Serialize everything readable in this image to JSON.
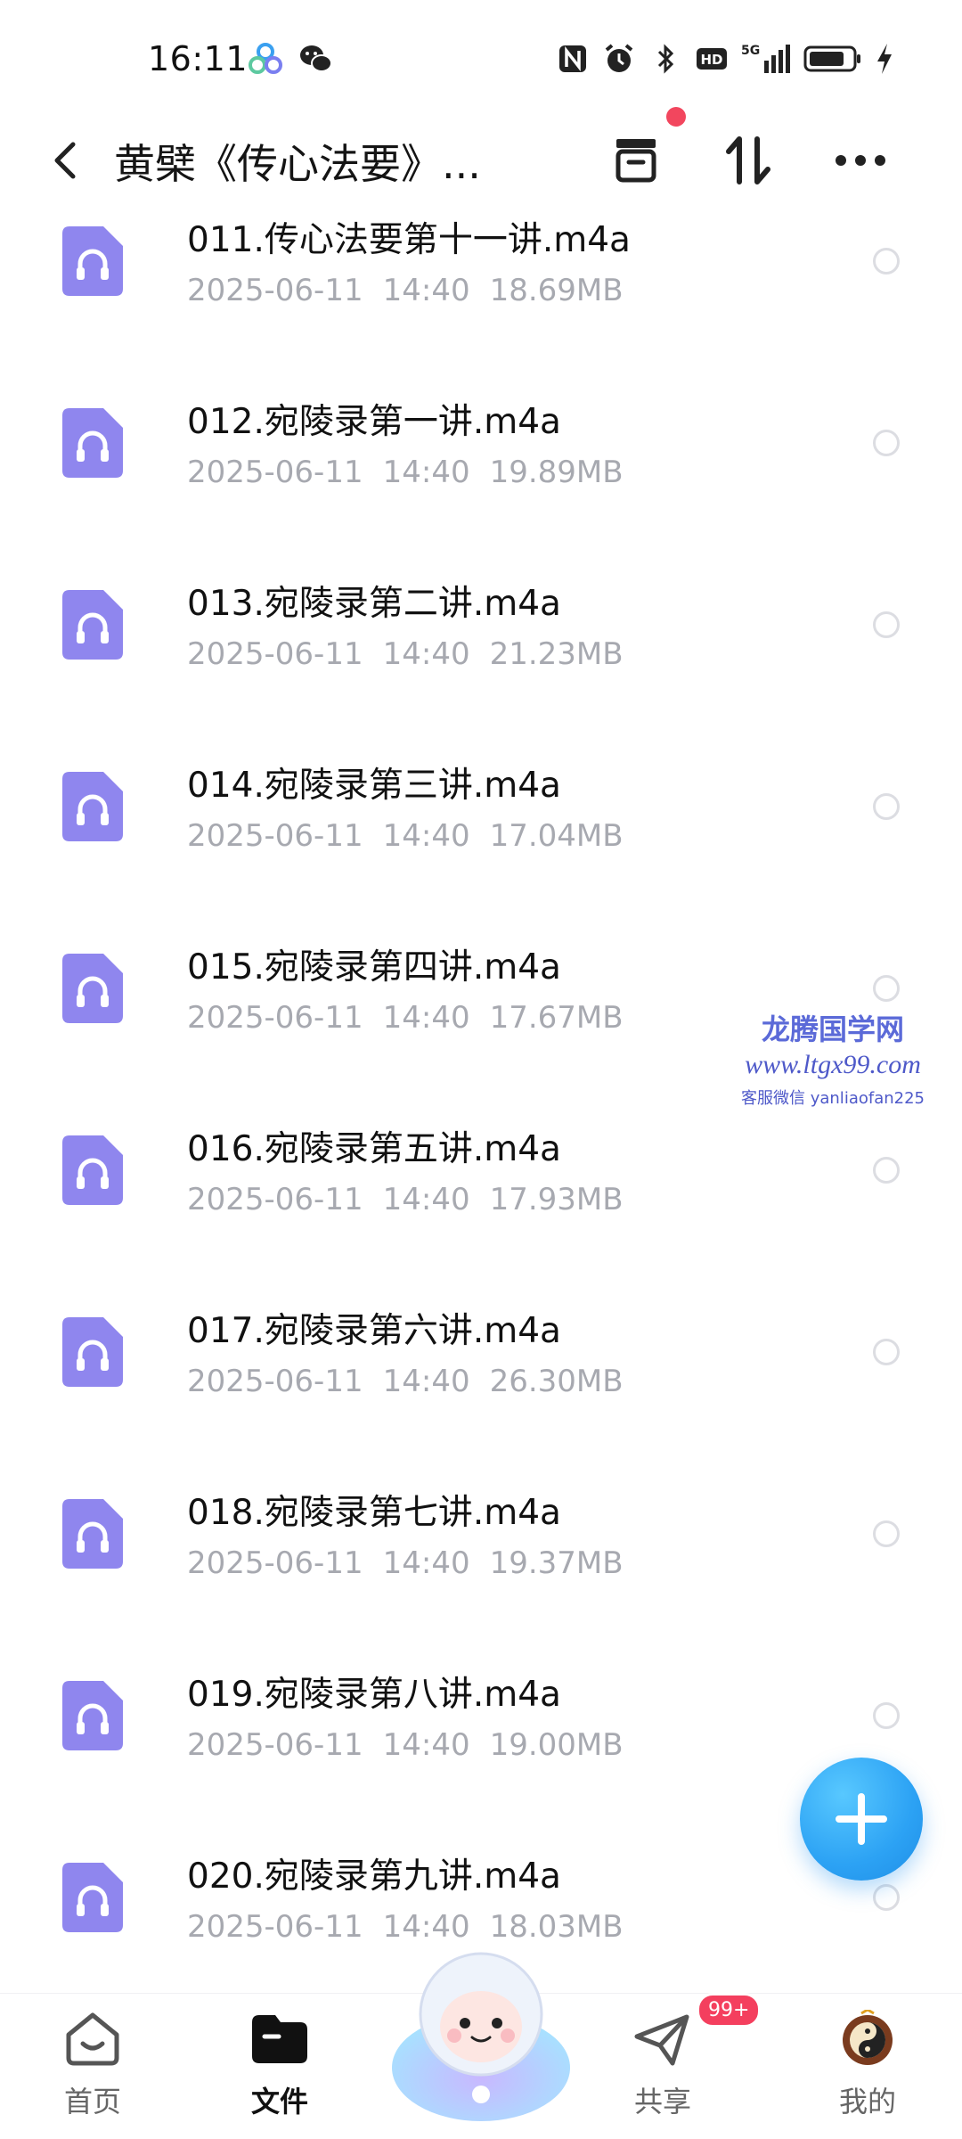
{
  "status_bar": {
    "time": "16:11",
    "network": "5G",
    "icons": [
      "cloud-app-icon",
      "wechat-icon",
      "nfc-icon",
      "alarm-icon",
      "bluetooth-icon",
      "hd-icon",
      "signal-icon",
      "battery-icon",
      "charging-icon"
    ]
  },
  "header": {
    "title": "黄檗《传心法要》...",
    "icons": [
      "back-icon",
      "archive-icon",
      "sort-icon",
      "more-icon"
    ]
  },
  "files": [
    {
      "name": "011.传心法要第十一讲.m4a",
      "date": "2025-06-11",
      "time": "14:40",
      "size": "18.69MB"
    },
    {
      "name": "012.宛陵录第一讲.m4a",
      "date": "2025-06-11",
      "time": "14:40",
      "size": "19.89MB"
    },
    {
      "name": "013.宛陵录第二讲.m4a",
      "date": "2025-06-11",
      "time": "14:40",
      "size": "21.23MB"
    },
    {
      "name": "014.宛陵录第三讲.m4a",
      "date": "2025-06-11",
      "time": "14:40",
      "size": "17.04MB"
    },
    {
      "name": "015.宛陵录第四讲.m4a",
      "date": "2025-06-11",
      "time": "14:40",
      "size": "17.67MB"
    },
    {
      "name": "016.宛陵录第五讲.m4a",
      "date": "2025-06-11",
      "time": "14:40",
      "size": "17.93MB"
    },
    {
      "name": "017.宛陵录第六讲.m4a",
      "date": "2025-06-11",
      "time": "14:40",
      "size": "26.30MB"
    },
    {
      "name": "018.宛陵录第七讲.m4a",
      "date": "2025-06-11",
      "time": "14:40",
      "size": "19.37MB"
    },
    {
      "name": "019.宛陵录第八讲.m4a",
      "date": "2025-06-11",
      "time": "14:40",
      "size": "19.00MB"
    },
    {
      "name": "020.宛陵录第九讲.m4a",
      "date": "2025-06-11",
      "time": "14:40",
      "size": "18.03MB"
    }
  ],
  "watermark": {
    "site_name": "龙腾国学网",
    "url": "www.ltgx99.com",
    "contact": "客服微信 yanliaofan225"
  },
  "bottom_nav": {
    "items": [
      {
        "label": "首页",
        "icon": "home-icon",
        "active": false
      },
      {
        "label": "文件",
        "icon": "folder-icon",
        "active": true
      },
      {
        "label": "共享",
        "icon": "share-icon",
        "active": false
      },
      {
        "label": "我的",
        "icon": "profile-avatar",
        "active": false
      }
    ],
    "share_badge": "99+"
  },
  "colors": {
    "accent": "#2ca2f4",
    "file_icon": "#8f86ee",
    "meta_text": "#a7a9b0",
    "badge": "#f43f5e",
    "notification_dot": "#f2465e"
  }
}
